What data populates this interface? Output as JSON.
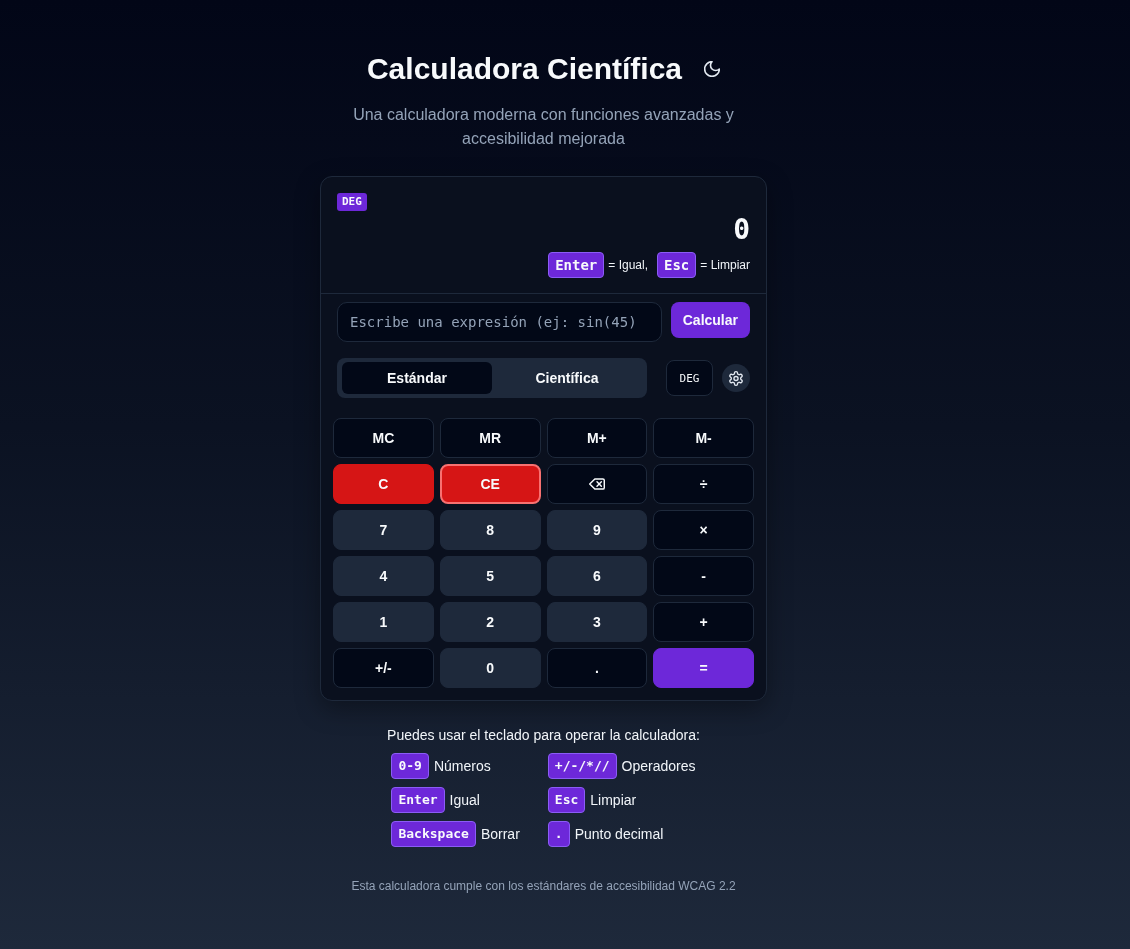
{
  "header": {
    "title": "Calculadora Científica",
    "subtitle": "Una calculadora moderna con funciones avanzadas y accesibilidad mejorada"
  },
  "display": {
    "mode_badge": "DEG",
    "value": "0",
    "shortcuts": [
      {
        "key": "Enter",
        "text": "= Igual,"
      },
      {
        "key": "Esc",
        "text": "= Limpiar"
      }
    ]
  },
  "expression": {
    "placeholder": "Escribe una expresión (ej: sin(45)",
    "button": "Calcular"
  },
  "tabs": [
    {
      "label": "Estándar",
      "selected": true
    },
    {
      "label": "Científica",
      "selected": false
    }
  ],
  "angle_button": "DEG",
  "keypad": [
    {
      "label": "MC",
      "kind": "memory",
      "focused": false
    },
    {
      "label": "MR",
      "kind": "memory",
      "focused": false
    },
    {
      "label": "M+",
      "kind": "memory",
      "focused": false
    },
    {
      "label": "M-",
      "kind": "memory",
      "focused": false
    },
    {
      "label": "C",
      "kind": "clear",
      "focused": false
    },
    {
      "label": "CE",
      "kind": "clear",
      "focused": true
    },
    {
      "kind": "backspace",
      "focused": false
    },
    {
      "label": "÷",
      "kind": "operator",
      "focused": false
    },
    {
      "label": "7",
      "kind": "digit",
      "focused": false
    },
    {
      "label": "8",
      "kind": "digit",
      "focused": false
    },
    {
      "label": "9",
      "kind": "digit",
      "focused": false
    },
    {
      "label": "×",
      "kind": "operator",
      "focused": false
    },
    {
      "label": "4",
      "kind": "digit",
      "focused": false
    },
    {
      "label": "5",
      "kind": "digit",
      "focused": false
    },
    {
      "label": "6",
      "kind": "digit",
      "focused": false
    },
    {
      "label": "-",
      "kind": "operator",
      "focused": false
    },
    {
      "label": "1",
      "kind": "digit",
      "focused": false
    },
    {
      "label": "2",
      "kind": "digit",
      "focused": false
    },
    {
      "label": "3",
      "kind": "digit",
      "focused": false
    },
    {
      "label": "+",
      "kind": "operator",
      "focused": false
    },
    {
      "label": "+/-",
      "kind": "operator",
      "focused": false
    },
    {
      "label": "0",
      "kind": "digit",
      "focused": false
    },
    {
      "label": ".",
      "kind": "operator",
      "focused": false
    },
    {
      "label": "=",
      "kind": "equals",
      "focused": false
    }
  ],
  "keyboard_help": {
    "title": "Puedes usar el teclado para operar la calculadora:",
    "items": [
      {
        "key": "0-9",
        "text": "Números"
      },
      {
        "key": "+/-/*//",
        "text": "Operadores"
      },
      {
        "key": "Enter",
        "text": "Igual"
      },
      {
        "key": "Esc",
        "text": "Limpiar"
      },
      {
        "key": "Backspace",
        "text": "Borrar"
      },
      {
        "key": ".",
        "text": "Punto decimal"
      }
    ]
  },
  "footer": "Esta calculadora cumple con los estándares de accesibilidad WCAG 2.2"
}
